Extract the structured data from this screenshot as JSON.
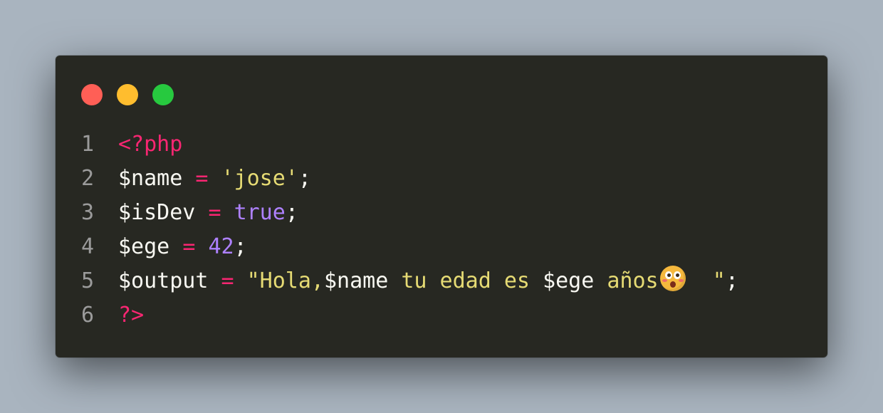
{
  "window": {
    "controls": [
      "close",
      "minimize",
      "maximize"
    ],
    "colors": {
      "background": "#272822",
      "close": "#ff5f56",
      "minimize": "#ffbd2e",
      "maximize": "#27c93f",
      "keyword": "#f92672",
      "string": "#e6db74",
      "constant": "#ae81ff",
      "text": "#f8f8f2",
      "line_number": "#9b9b9b"
    }
  },
  "code": {
    "language": "php",
    "lines": [
      {
        "number": "1",
        "tokens": [
          {
            "text": "<?php",
            "kind": "tag"
          }
        ]
      },
      {
        "number": "2",
        "tokens": [
          {
            "text": "$name",
            "kind": "var"
          },
          {
            "text": " ",
            "kind": "punc"
          },
          {
            "text": "=",
            "kind": "op"
          },
          {
            "text": " ",
            "kind": "punc"
          },
          {
            "text": "'jose'",
            "kind": "str"
          },
          {
            "text": ";",
            "kind": "punc"
          }
        ]
      },
      {
        "number": "3",
        "tokens": [
          {
            "text": "$isDev",
            "kind": "var"
          },
          {
            "text": " ",
            "kind": "punc"
          },
          {
            "text": "=",
            "kind": "op"
          },
          {
            "text": " ",
            "kind": "punc"
          },
          {
            "text": "true",
            "kind": "bool"
          },
          {
            "text": ";",
            "kind": "punc"
          }
        ]
      },
      {
        "number": "4",
        "tokens": [
          {
            "text": "$ege",
            "kind": "var"
          },
          {
            "text": " ",
            "kind": "punc"
          },
          {
            "text": "=",
            "kind": "op"
          },
          {
            "text": " ",
            "kind": "punc"
          },
          {
            "text": "42",
            "kind": "num"
          },
          {
            "text": ";",
            "kind": "punc"
          }
        ]
      },
      {
        "number": "5",
        "tokens": [
          {
            "text": "$output",
            "kind": "var"
          },
          {
            "text": " ",
            "kind": "punc"
          },
          {
            "text": "=",
            "kind": "op"
          },
          {
            "text": " ",
            "kind": "punc"
          },
          {
            "text": "\"Hola,",
            "kind": "str"
          },
          {
            "text": "$name",
            "kind": "interp"
          },
          {
            "text": " tu edad es ",
            "kind": "str"
          },
          {
            "text": "$ege",
            "kind": "interp"
          },
          {
            "text": " años",
            "kind": "str"
          },
          {
            "text": "",
            "kind": "emoji",
            "icon": "flushed-face-emoji"
          },
          {
            "text": "  \"",
            "kind": "str"
          },
          {
            "text": ";",
            "kind": "punc"
          }
        ]
      },
      {
        "number": "6",
        "tokens": [
          {
            "text": "?>",
            "kind": "tag"
          }
        ]
      }
    ]
  }
}
